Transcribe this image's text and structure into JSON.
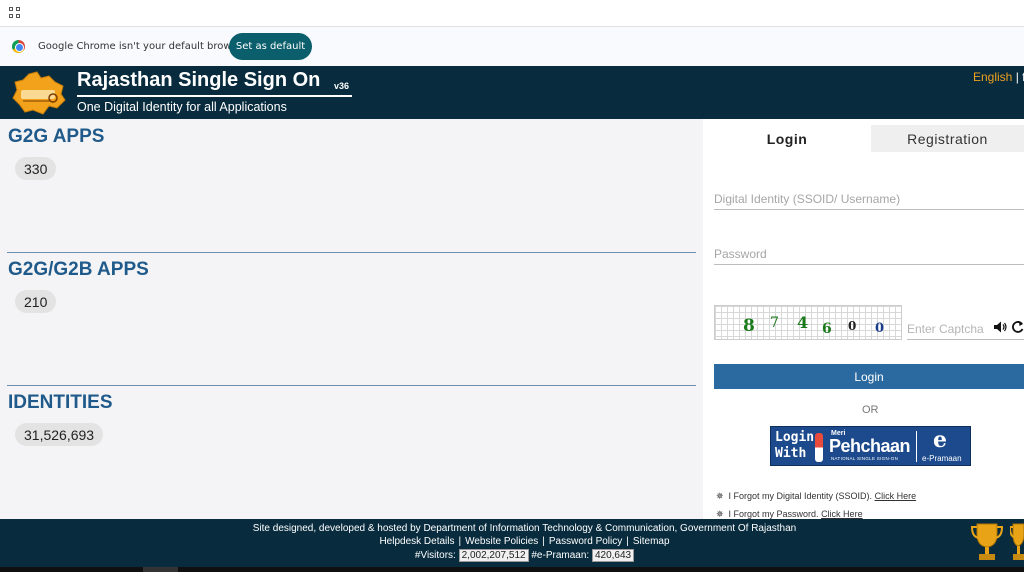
{
  "browser": {
    "infobar_text": "Google Chrome isn't your default browser",
    "default_button_label": "Set as default"
  },
  "header": {
    "title": "Rajasthan Single Sign On",
    "version": "v36",
    "subtitle": "One Digital Identity for all Applications",
    "language": "English",
    "language_sep": "| f"
  },
  "stats": [
    {
      "title": "G2G APPS",
      "value": "330"
    },
    {
      "title": "G2G/G2B APPS",
      "value": "210"
    },
    {
      "title": "IDENTITIES",
      "value": "31,526,693"
    }
  ],
  "login_panel": {
    "tab_login": "Login",
    "tab_registration": "Registration",
    "ssoid_placeholder": "Digital Identity (SSOID/ Username)",
    "password_placeholder": "Password",
    "captcha_digits": [
      "8",
      "7",
      "4",
      "6",
      "0",
      "0"
    ],
    "captcha_placeholder": "Enter Captcha",
    "login_button": "Login",
    "or_text": "OR",
    "meri_pehchaan": {
      "login_with_1": "Login",
      "login_with_2": "With",
      "meri": "Meri",
      "pehchaan": "Pehchaan",
      "tagline": "NATIONAL SINGLE SIGN-ON",
      "epramaan_letter": "e",
      "epramaan": "e-Pramaan"
    },
    "forgot_ssoid_text": "I Forgot my Digital Identity (SSOID).",
    "forgot_ssoid_link": "Click Here",
    "forgot_password_text": "I Forgot my Password.",
    "forgot_password_link": "Click Here"
  },
  "footer": {
    "credit": "Site designed, developed & hosted by Department of Information Technology & Communication, Government Of Rajasthan",
    "links": [
      "Helpdesk Details",
      "Website Policies",
      "Password Policy",
      "Sitemap"
    ],
    "visitors_label": "#Visitors:",
    "visitors_value": "2,002,207,512",
    "epramaan_label": "#e-Pramaan:",
    "epramaan_value": "420,643"
  },
  "colors": {
    "header_bg": "#082c3e",
    "accent_blue": "#2b6aa1",
    "stat_title": "#1f5a8a",
    "language_orange": "#f0a020"
  }
}
